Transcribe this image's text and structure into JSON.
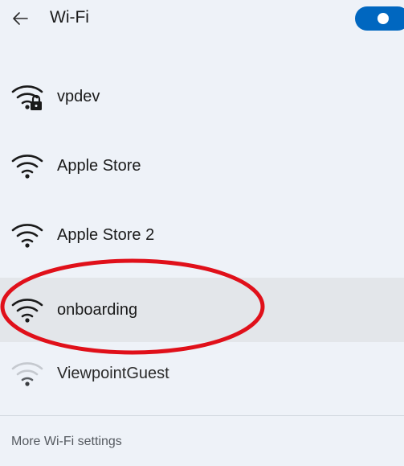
{
  "header": {
    "title": "Wi-Fi",
    "back_icon": "back-arrow-icon",
    "wifi_enabled": true,
    "accent_color": "#0067c0"
  },
  "networks": [
    {
      "name": "vpdev",
      "secured": true,
      "signal": "full",
      "selected": false
    },
    {
      "name": "Apple Store",
      "secured": false,
      "signal": "full",
      "selected": false
    },
    {
      "name": "Apple Store 2",
      "secured": false,
      "signal": "full",
      "selected": false
    },
    {
      "name": "onboarding",
      "secured": false,
      "signal": "full",
      "selected": true
    },
    {
      "name": "ViewpointGuest",
      "secured": false,
      "signal": "weak",
      "selected": false
    }
  ],
  "footer": {
    "more_settings_label": "More Wi-Fi settings"
  },
  "annotation": {
    "shape": "ellipse",
    "color": "#e0101a",
    "target": "onboarding"
  }
}
